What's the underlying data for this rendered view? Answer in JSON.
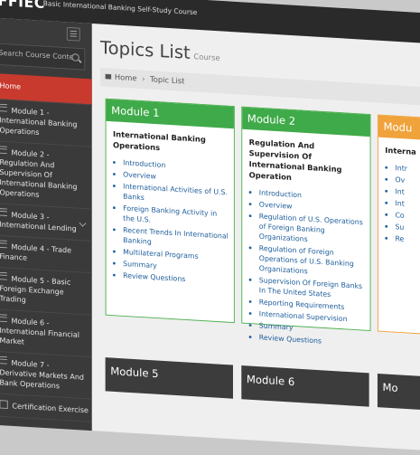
{
  "header": {
    "brand": "FFIEC",
    "subtitle": "Basic International Banking Self-Study Course"
  },
  "search": {
    "placeholder": "Search Course Content..."
  },
  "sidebar": {
    "items": [
      {
        "label": "Home"
      },
      {
        "label": "Module 1 - International Banking Operations"
      },
      {
        "label": "Module 2 - Regulation And Supervision Of International Banking Operations"
      },
      {
        "label": "Module 3 - International Lending"
      },
      {
        "label": "Module 4 - Trade Finance"
      },
      {
        "label": "Module 5 - Basic Foreign Exchange Trading"
      },
      {
        "label": "Module 6 - International Financial Market"
      },
      {
        "label": "Module 7 - Derivative Markets And Bank Operations"
      },
      {
        "label": "Certification Exercise"
      }
    ]
  },
  "page": {
    "title": "Topics List",
    "subtitle": "Course"
  },
  "breadcrumb": {
    "home": "Home",
    "current": "Topic List"
  },
  "modules": [
    {
      "header": "Module 1",
      "title": "International Banking Operations",
      "topics": [
        "Introduction",
        "Overview",
        "International Activities of U.S. Banks",
        "Foreign Banking Activity in the U.S.",
        "Recent Trends In International Banking",
        "Multilateral Programs",
        "Summary",
        "Review Questions"
      ]
    },
    {
      "header": "Module 2",
      "title": "Regulation And Supervision Of International Banking Operation",
      "topics": [
        "Introduction",
        "Overview",
        "Regulation of U.S. Operations of Foreign Banking Organizations",
        "Regulation of Foreign Operations of U.S. Banking Organizations",
        "Supervision Of Foreign Banks In The United States",
        "Reporting Requirements",
        "International Supervision",
        "Summary",
        "Review Questions"
      ]
    },
    {
      "header": "Modu",
      "title": "Interna",
      "topics": [
        "Intr",
        "Ov",
        "Int",
        "Int",
        "Co",
        "Su",
        "Re"
      ]
    }
  ],
  "bottom_modules": [
    {
      "header": "Module 5"
    },
    {
      "header": "Module 6"
    },
    {
      "header": "Mo"
    }
  ]
}
